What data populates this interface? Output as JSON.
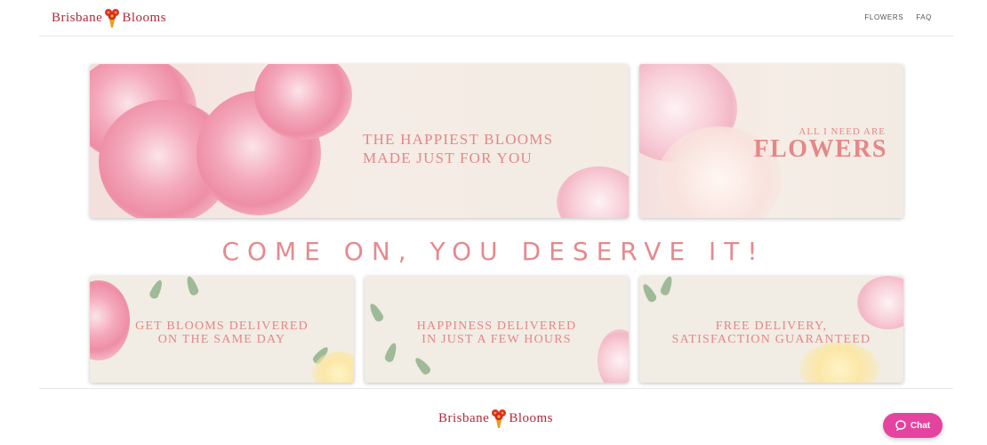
{
  "brand": {
    "name_left": "Brisbane",
    "name_right": "Blooms",
    "flower_icon": "bouquet-icon"
  },
  "nav": {
    "items": [
      {
        "label": "FLOWERS"
      },
      {
        "label": "FAQ"
      }
    ]
  },
  "banners": {
    "main": {
      "line1": "THE HAPPIEST BLOOMS",
      "line2": "MADE JUST FOR YOU"
    },
    "side": {
      "small": "ALL I NEED ARE",
      "big": "FLOWERS"
    }
  },
  "tagline": "COME ON, YOU DESERVE IT!",
  "cards": [
    {
      "line1": "GET BLOOMS DELIVERED",
      "line2": "ON THE SAME DAY"
    },
    {
      "line1": "HAPPINESS DELIVERED",
      "line2": "IN JUST A FEW HOURS"
    },
    {
      "line1": "FREE DELIVERY,",
      "line2": "SATISFACTION GUARANTEED"
    }
  ],
  "chat": {
    "label": "Chat",
    "icon": "chat-bubble-icon"
  },
  "colors": {
    "brand_red": "#b02a3c",
    "accent_pink": "#e58787",
    "chat_pink": "#e4439f"
  }
}
